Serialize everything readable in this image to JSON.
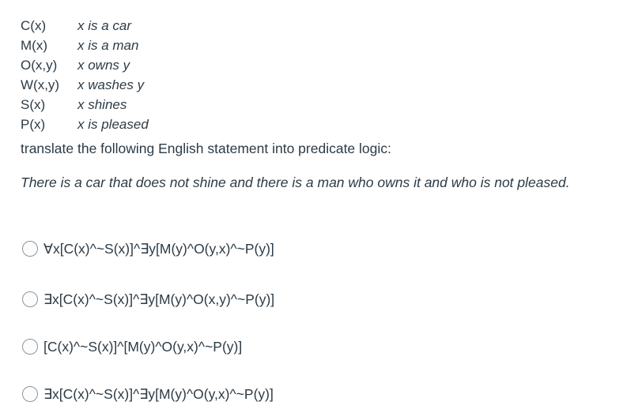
{
  "definitions": [
    {
      "symbol": "C(x)",
      "meaning": "x is a car"
    },
    {
      "symbol": "M(x)",
      "meaning": "x is a man"
    },
    {
      "symbol": "O(x,y)",
      "meaning": "x owns y"
    },
    {
      "symbol": "W(x,y)",
      "meaning": "x washes y"
    },
    {
      "symbol": "S(x)",
      "meaning": "x shines"
    },
    {
      "symbol": "P(x)",
      "meaning": "x is pleased"
    }
  ],
  "question": {
    "instruction": "translate the following English statement into predicate logic:",
    "statement": "There is a car that does not shine and there is a man who owns it and who is not pleased."
  },
  "options": [
    {
      "label": "∀x[C(x)^~S(x)]^∃y[M(y)^O(y,x)^~P(y)]",
      "selected": false
    },
    {
      "label": "∃x[C(x)^~S(x)]^∃y[M(y)^O(x,y)^~P(y)]",
      "selected": false
    },
    {
      "label": "[C(x)^~S(x)]^[M(y)^O(y,x)^~P(y)]",
      "selected": false
    },
    {
      "label": "∃x[C(x)^~S(x)]^∃y[M(y)^O(y,x)^~P(y)]",
      "selected": false
    }
  ]
}
